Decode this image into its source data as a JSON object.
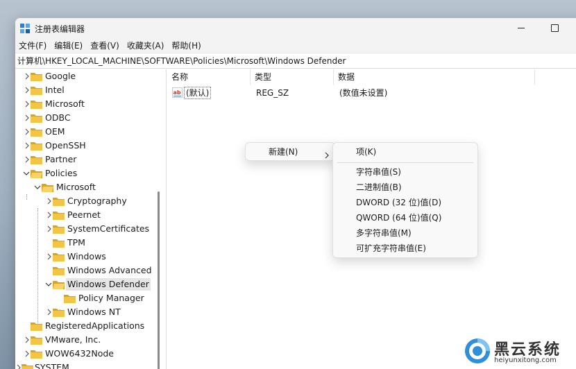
{
  "window": {
    "title": "注册表编辑器",
    "menu": [
      "文件(F)",
      "编辑(E)",
      "查看(V)",
      "收藏夹(A)",
      "帮助(H)"
    ],
    "address": "计算机\\HKEY_LOCAL_MACHINE\\SOFTWARE\\Policies\\Microsoft\\Windows Defender"
  },
  "tree": {
    "top_items": [
      "Google",
      "Intel",
      "Microsoft",
      "ODBC",
      "OEM",
      "OpenSSH",
      "Partner"
    ],
    "policies": "Policies",
    "microsoft": "Microsoft",
    "microsoft_children": [
      "Cryptography",
      "Peernet",
      "SystemCertificates",
      "TPM",
      "Windows",
      "Windows Advanced T"
    ],
    "windows_defender": "Windows Defender",
    "policy_manager": "Policy Manager",
    "windows_nt": "Windows NT",
    "after_items": [
      "RegisteredApplications",
      "VMware, Inc.",
      "WOW6432Node"
    ],
    "system": "SYSTEM"
  },
  "list": {
    "columns": [
      "名称",
      "类型",
      "数据"
    ],
    "rows": [
      {
        "name": "(默认)",
        "type": "REG_SZ",
        "data": "(数值未设置)"
      }
    ]
  },
  "context_menu": {
    "new_label": "新建(N)",
    "submenu": {
      "key": "项(K)",
      "values": [
        "字符串值(S)",
        "二进制值(B)",
        "DWORD (32 位)值(D)",
        "QWORD (64 位)值(Q)",
        "多字符串值(M)",
        "可扩充字符串值(E)"
      ]
    }
  },
  "watermark": {
    "title": "黑云系统",
    "url": "heiyunxitong.com"
  },
  "colors": {
    "folder": "#f3c544",
    "folder_dark": "#d9a520",
    "accent": "#0078d4"
  },
  "icons": {
    "app": "registry-editor-icon",
    "folder": "folder-icon",
    "value": "string-value-icon"
  }
}
